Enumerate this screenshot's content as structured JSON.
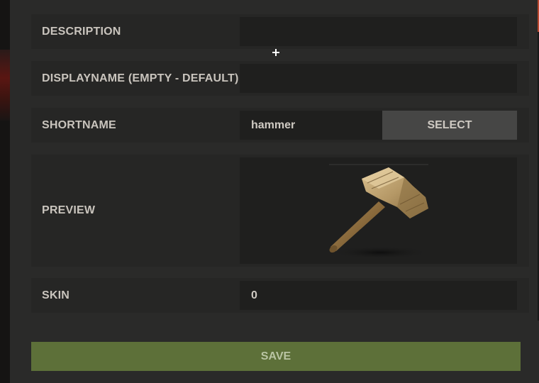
{
  "form": {
    "rows": [
      {
        "label": "DESCRIPTION",
        "value": ""
      },
      {
        "label": "DISPLAYNAME (EMPTY - DEFAULT)",
        "value": ""
      },
      {
        "label": "SHORTNAME",
        "value": "hammer",
        "button": "SELECT"
      },
      {
        "label": "PREVIEW",
        "image": "hammer-item-icon"
      },
      {
        "label": "SKIN",
        "value": "0"
      }
    ],
    "save_label": "SAVE"
  },
  "colors": {
    "panel": "#2a2a29",
    "row": "#262625",
    "field": "#1f1f1e",
    "select_button": "#464645",
    "save_button": "#5d7039",
    "scrollbar_thumb": "#b9482f"
  },
  "scrollbar": {
    "position": 0.0,
    "visible_fraction": 0.1
  }
}
